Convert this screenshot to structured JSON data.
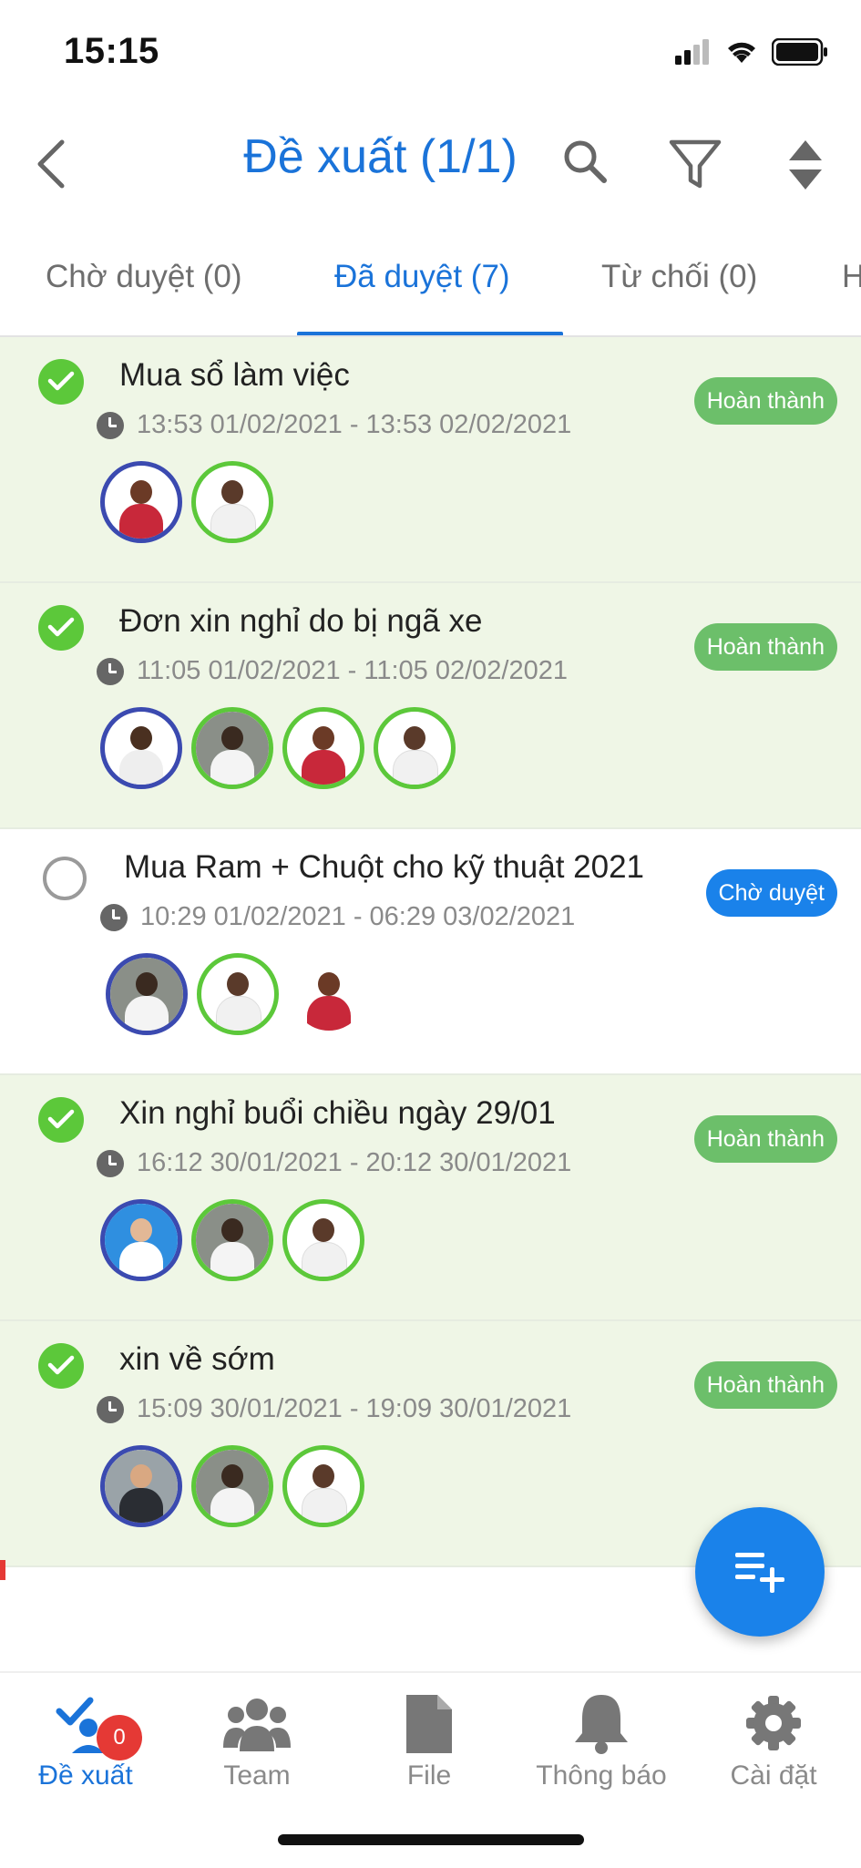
{
  "status_bar": {
    "time": "15:15"
  },
  "header": {
    "title": "Đề xuất (1/1)"
  },
  "tabs": [
    {
      "label": "Chờ duyệt (0)",
      "active": false
    },
    {
      "label": "Đã duyệt (7)",
      "active": true
    },
    {
      "label": "Từ chối (0)",
      "active": false
    },
    {
      "label": "H",
      "active": false
    }
  ],
  "proposals": [
    {
      "title": "Mua sổ làm việc",
      "time": "13:53 01/02/2021  - 13:53 02/02/2021",
      "status": "Hoàn thành",
      "approved": true
    },
    {
      "title": "Đơn xin nghỉ do bị ngã xe",
      "time": "11:05 01/02/2021  - 11:05 02/02/2021",
      "status": "Hoàn thành",
      "approved": true
    },
    {
      "title": "Mua Ram + Chuột cho kỹ thuật 2021",
      "time": "10:29 01/02/2021  - 06:29 03/02/2021",
      "status": "Chờ duyệt",
      "approved": false
    },
    {
      "title": "Xin nghỉ buổi chiều ngày 29/01",
      "time": "16:12 30/01/2021  - 20:12 30/01/2021",
      "status": "Hoàn thành",
      "approved": true
    },
    {
      "title": "xin về sớm",
      "time": "15:09 30/01/2021  - 19:09 30/01/2021",
      "status": "Hoàn thành",
      "approved": true
    }
  ],
  "bottom_nav": [
    {
      "label": "Đề xuất",
      "icon": "proposal-icon",
      "active": true,
      "badge": "0"
    },
    {
      "label": "Team",
      "icon": "team-icon",
      "active": false
    },
    {
      "label": "File",
      "icon": "file-icon",
      "active": false
    },
    {
      "label": "Thông báo",
      "icon": "bell-icon",
      "active": false
    },
    {
      "label": "Cài đặt",
      "icon": "gear-icon",
      "active": false
    }
  ],
  "colors": {
    "accent": "#1a73d9",
    "approved": "#5cc83a",
    "done_badge": "#6cbf6a",
    "pending_badge": "#1a82ea",
    "done_row": "#eff6e6"
  }
}
